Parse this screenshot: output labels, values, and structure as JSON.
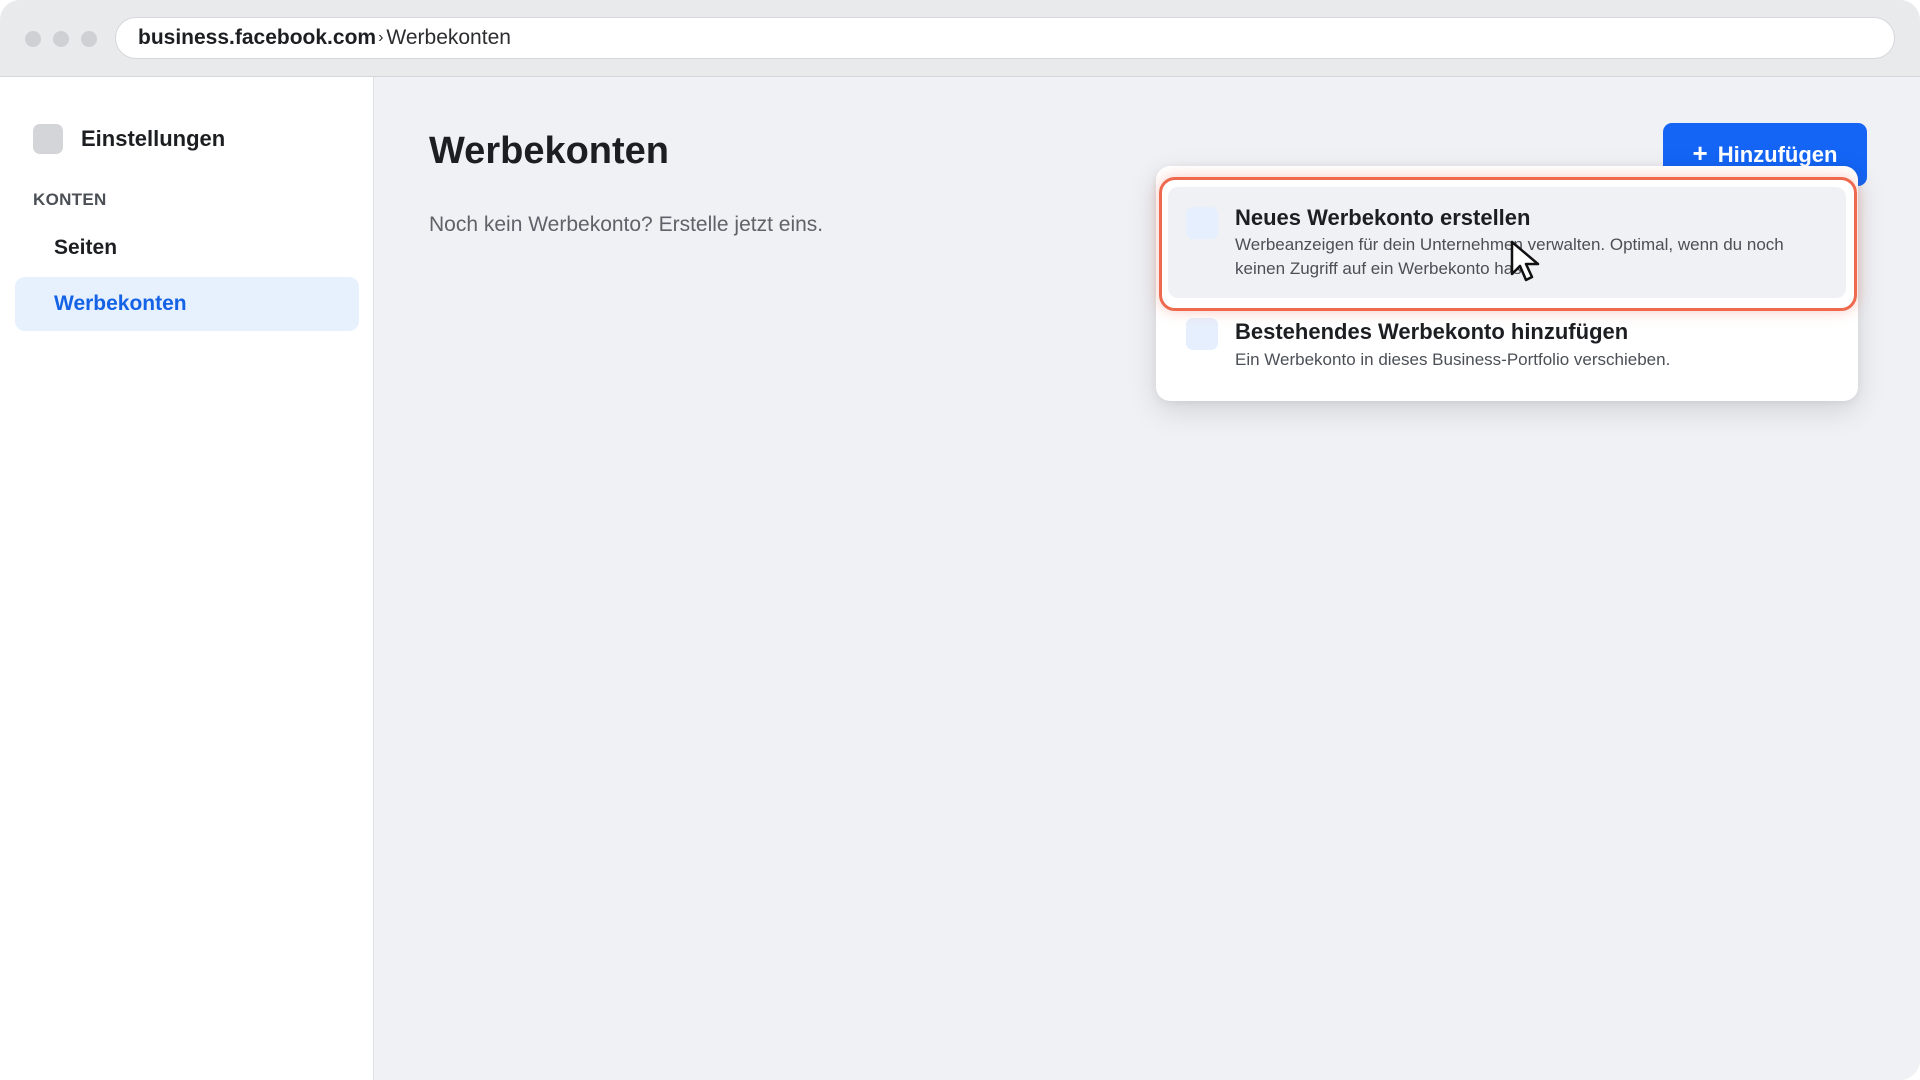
{
  "browser": {
    "url_domain": "business.facebook.com",
    "url_separator": "›",
    "url_path": "Werbekonten"
  },
  "sidebar": {
    "title": "Einstellungen",
    "section": "KONTEN",
    "items": [
      {
        "label": "Seiten",
        "active": false
      },
      {
        "label": "Werbekonten",
        "active": true
      }
    ]
  },
  "main": {
    "title": "Werbekonten",
    "empty_text": "Noch kein Werbekonto? Erstelle jetzt eins.",
    "add_button": {
      "icon": "plus-icon",
      "plus": "+",
      "label": "Hinzufügen"
    }
  },
  "dropdown": {
    "options": [
      {
        "title": "Neues Werbekonto erstellen",
        "description": "Werbeanzeigen für dein Unternehmen verwalten. Optimal, wenn du noch keinen Zugriff auf ein Werbekonto hast.",
        "highlighted": true
      },
      {
        "title": "Bestehendes Werbekonto hinzufügen",
        "description": "Ein Werbekonto in dieses Business-Portfolio verschieben.",
        "highlighted": false
      }
    ]
  },
  "colors": {
    "accent": "#1465f5",
    "active_nav_bg": "#e7f0fd",
    "highlight_border": "#ee6a4e",
    "page_bg": "#f0f1f5"
  }
}
